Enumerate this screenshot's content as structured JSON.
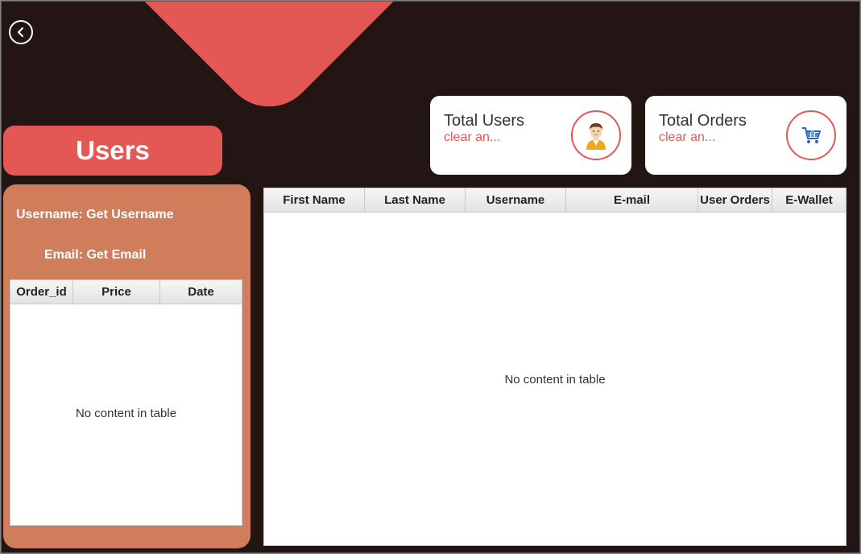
{
  "title": "Users",
  "profile": {
    "username_label": "Username: Get Username",
    "email_label": "Email: Get Email"
  },
  "stats": {
    "users": {
      "title": "Total Users",
      "value": "clear an...",
      "icon": "user-avatar-icon"
    },
    "orders": {
      "title": "Total Orders",
      "value": "clear an...",
      "icon": "shopping-cart-icon"
    }
  },
  "orders_table": {
    "columns": [
      "Order_id",
      "Price",
      "Date"
    ],
    "rows": [],
    "empty_text": "No content in table"
  },
  "users_table": {
    "columns": [
      "First Name",
      "Last Name",
      "Username",
      "E-mail",
      "User Orders",
      "E-Wallet"
    ],
    "rows": [],
    "empty_text": "No content in table"
  },
  "colors": {
    "background": "#221514",
    "accent": "#e35754",
    "panel": "#d07d5c"
  },
  "icons": {
    "back": "back-arrow-icon"
  }
}
